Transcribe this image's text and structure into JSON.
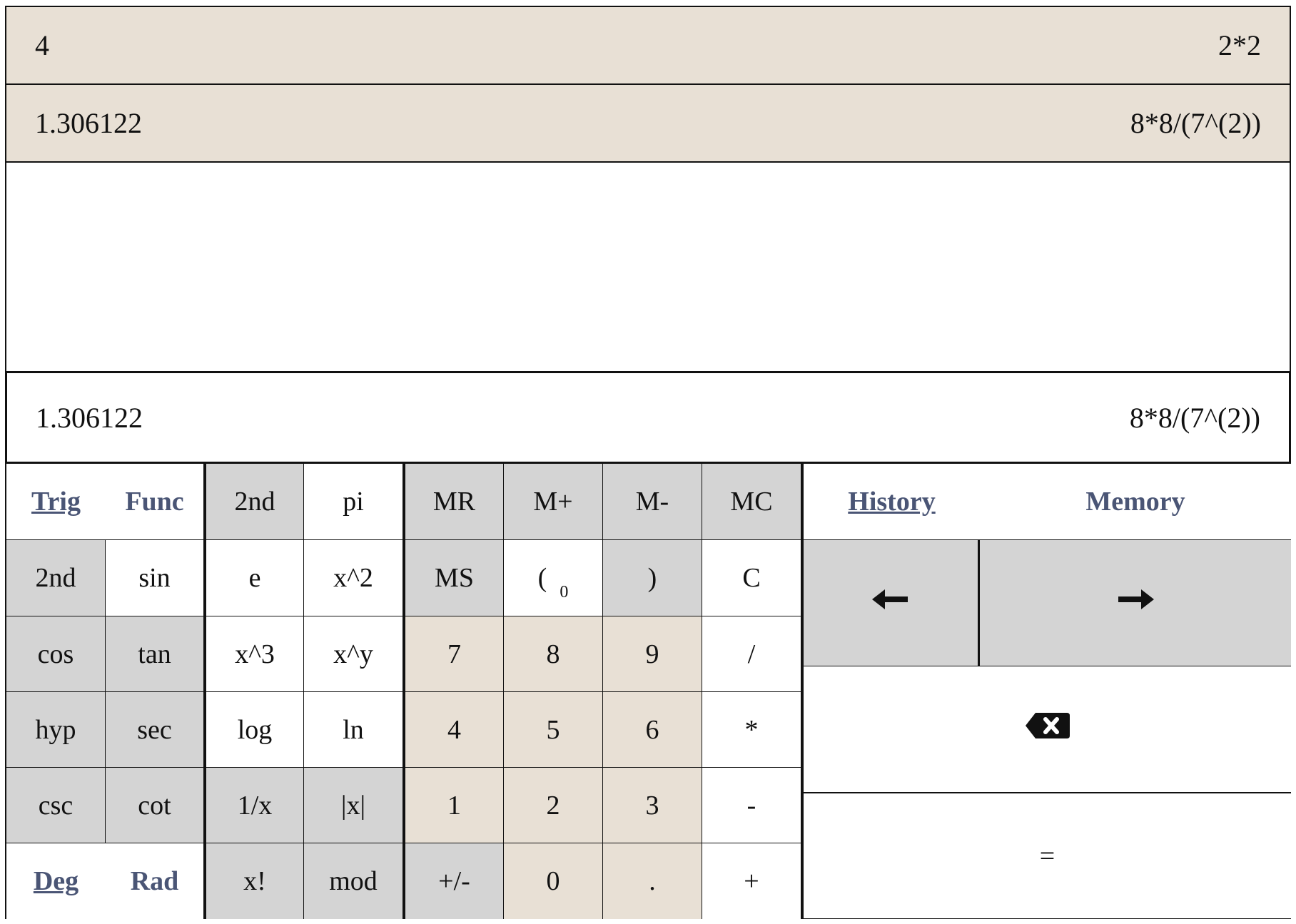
{
  "history": [
    {
      "result": "4",
      "expression": "2*2"
    },
    {
      "result": "1.306122",
      "expression": "8*8/(7^(2))"
    }
  ],
  "display": {
    "result": "1.306122",
    "expression": "8*8/(7^(2))"
  },
  "tabs": {
    "trig": "Trig",
    "func": "Func",
    "deg": "Deg",
    "rad": "Rad",
    "history": "History",
    "memory": "Memory"
  },
  "keys": {
    "second_top": "2nd",
    "pi": "pi",
    "mr": "MR",
    "mplus": "M+",
    "mminus": "M-",
    "mc": "MC",
    "second_left": "2nd",
    "sin": "sin",
    "e": "e",
    "x2": "x^2",
    "ms": "MS",
    "lparen": "(",
    "paren_count": "0",
    "rparen": ")",
    "c": "C",
    "cos": "cos",
    "tan": "tan",
    "x3": "x^3",
    "xy": "x^y",
    "n7": "7",
    "n8": "8",
    "n9": "9",
    "div": "/",
    "hyp": "hyp",
    "sec": "sec",
    "log": "log",
    "ln": "ln",
    "n4": "4",
    "n5": "5",
    "n6": "6",
    "mul": "*",
    "csc": "csc",
    "cot": "cot",
    "inv": "1/x",
    "abs": "|x|",
    "n1": "1",
    "n2": "2",
    "n3": "3",
    "sub": "-",
    "fact": "x!",
    "mod": "mod",
    "neg": "+/-",
    "n0": "0",
    "dot": ".",
    "add": "+",
    "equals": "="
  },
  "icons": {
    "left": "arrow-left-icon",
    "right": "arrow-right-icon",
    "backspace": "backspace-icon"
  },
  "colors": {
    "gray": "#d4d4d4",
    "beige": "#e8e0d5",
    "link": "#4a5575"
  }
}
